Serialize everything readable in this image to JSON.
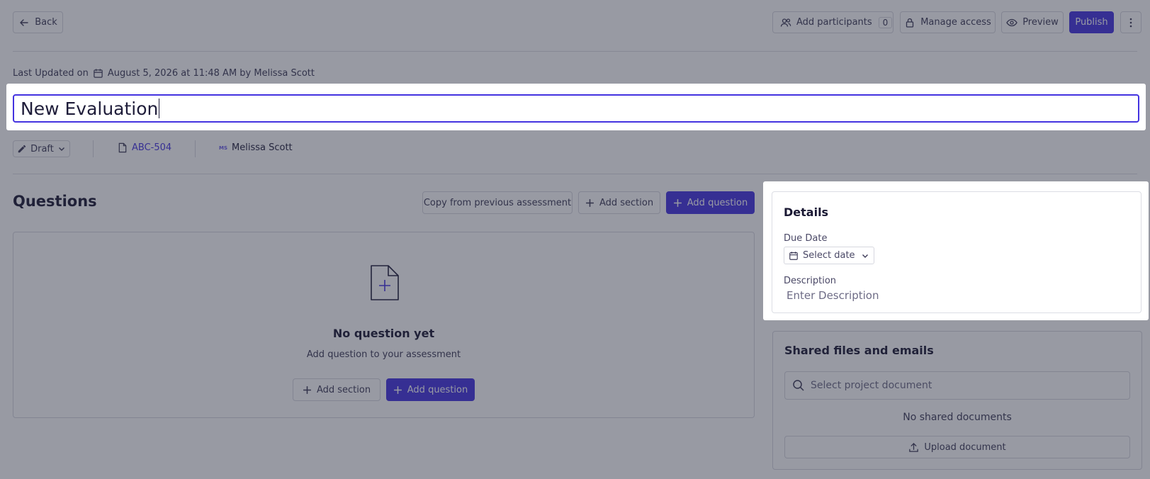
{
  "header": {
    "back_label": "Back",
    "add_participants_label": "Add participants",
    "participants_count": "0",
    "manage_access_label": "Manage access",
    "preview_label": "Preview",
    "publish_label": "Publish"
  },
  "meta": {
    "last_updated_prefix": "Last Updated on",
    "last_updated_value": "August 5, 2026 at 11:48 AM by Melissa Scott"
  },
  "title": {
    "value": "New Evaluation"
  },
  "info_bar": {
    "status_label": "Draft",
    "doc_id": "ABC-504",
    "owner_initials": "MS",
    "owner_name": "Melissa Scott"
  },
  "questions": {
    "heading": "Questions",
    "copy_label": "Copy from previous assessment",
    "add_section_label": "Add section",
    "add_question_label": "Add question",
    "empty_title": "No question yet",
    "empty_subtitle": "Add question to your assessment"
  },
  "details": {
    "title": "Details",
    "due_date_label": "Due Date",
    "date_placeholder": "Select date",
    "description_label": "Description",
    "description_placeholder": "Enter Description"
  },
  "shared": {
    "title": "Shared files and emails",
    "search_placeholder": "Select project document",
    "empty_text": "No shared documents",
    "upload_label": "Upload document"
  },
  "colors": {
    "accent": "#4433e0",
    "overlay": "#282c3e"
  }
}
